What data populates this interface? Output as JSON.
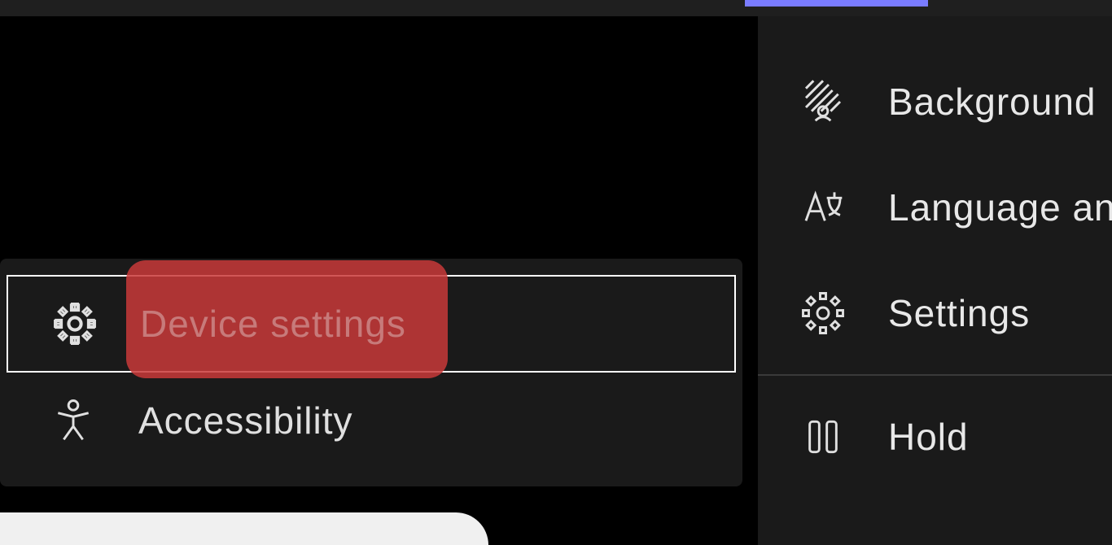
{
  "submenu": {
    "items": [
      {
        "label": "Device settings",
        "icon": "gear-icon"
      },
      {
        "label": "Accessibility",
        "icon": "accessibility-icon"
      }
    ]
  },
  "rightMenu": {
    "group1": [
      {
        "label": "Background",
        "icon": "background-icon"
      },
      {
        "label": "Language an",
        "icon": "language-icon"
      },
      {
        "label": "Settings",
        "icon": "gear-icon"
      }
    ],
    "group2": [
      {
        "label": "Hold",
        "icon": "hold-icon"
      }
    ]
  }
}
